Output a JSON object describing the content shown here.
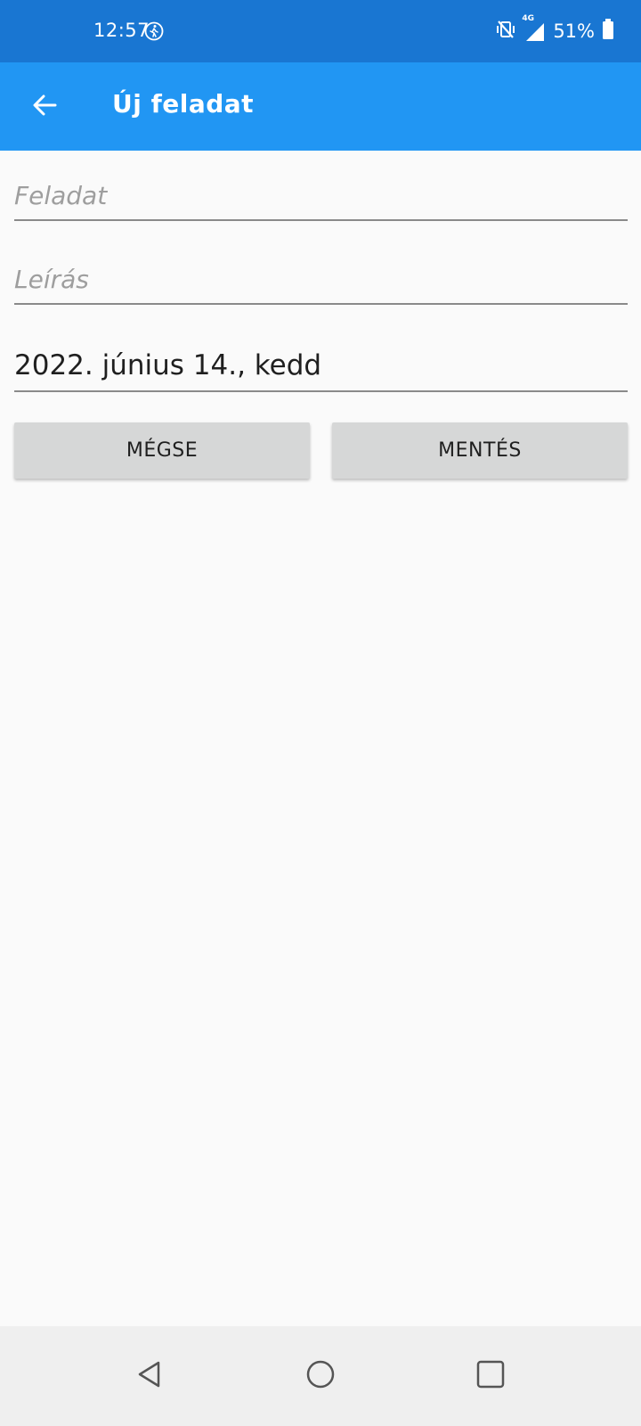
{
  "status_bar": {
    "time": "12:57",
    "network_label": "4G",
    "battery": "51%",
    "icons": [
      "walking-icon",
      "mute-vibrate-icon",
      "signal-icon",
      "battery-icon"
    ]
  },
  "app_bar": {
    "title": "Új feladat",
    "back_icon": "arrow-left-icon"
  },
  "form": {
    "task_placeholder": "Feladat",
    "task_value": "",
    "description_placeholder": "Leírás",
    "description_value": "",
    "date_value": "2022. június 14., kedd"
  },
  "buttons": {
    "cancel_label": "MÉGSE",
    "save_label": "MENTÉS"
  },
  "nav_bar": {
    "icons": [
      "nav-back-icon",
      "nav-home-icon",
      "nav-recents-icon"
    ]
  },
  "colors": {
    "status_bar": "#1976d2",
    "app_bar": "#2196f3",
    "background": "#fafafa",
    "button": "#d6d7d7"
  }
}
